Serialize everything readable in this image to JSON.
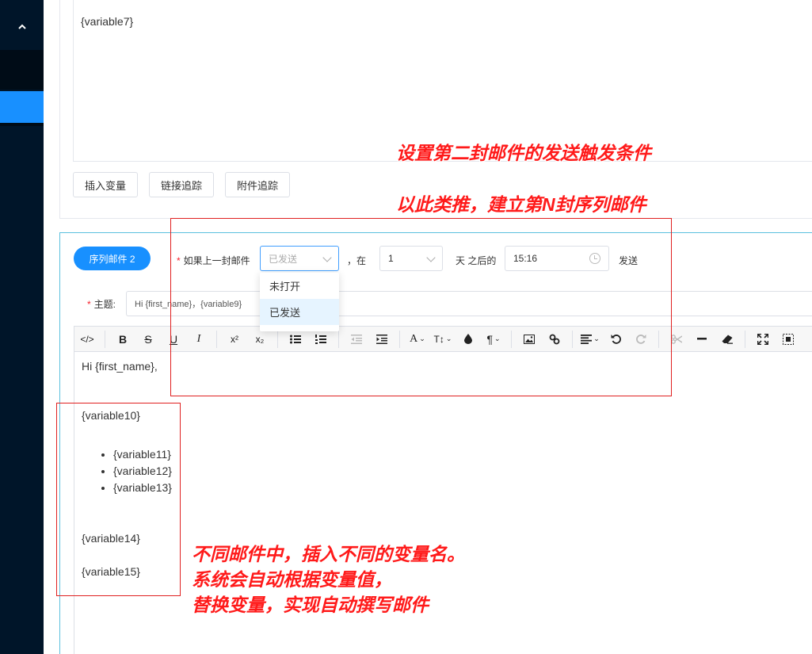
{
  "editor_top": {
    "line": "{variable7}"
  },
  "editor_buttons": {
    "insert_variable": "插入变量",
    "link_tracking": "链接追踪",
    "attachment_tracking": "附件追踪"
  },
  "sequence": {
    "badge": "序列邮件 2",
    "condition_label": "如果上一封邮件",
    "condition_value": "已发送",
    "in_label": "，在",
    "days_value": "1",
    "days_after_label": "天 之后的",
    "time_value": "15:16",
    "send_label": "发送",
    "dropdown_options": [
      "未打开",
      "已发送"
    ],
    "subject_label": "主题:",
    "subject_value": "Hi {first_name}，{variable9}"
  },
  "toolbar": {
    "code": "</>",
    "bold": "B",
    "strike": "S",
    "underline": "U",
    "italic": "I",
    "superscript": "x²",
    "subscript": "x₂",
    "font_color": "A",
    "font_size": "T↕",
    "paragraph": "¶"
  },
  "body": {
    "greeting": "Hi {first_name},",
    "var10": "{variable10}",
    "bullets": [
      "{variable11}",
      "{variable12}",
      "{variable13}"
    ],
    "var14": "{variable14}",
    "var15": "{variable15}"
  },
  "annotations": {
    "trigger": "设置第二封邮件的发送触发条件",
    "nth": "以此类推，建立第N封序列邮件",
    "variables": [
      "不同邮件中，插入不同的变量名。",
      "系统会自动根据变量值，",
      "替换变量，实现自动撰写邮件"
    ]
  },
  "colors": {
    "sidebar": "#001529",
    "active": "#1890ff",
    "annotation": "#ff1a1a"
  }
}
